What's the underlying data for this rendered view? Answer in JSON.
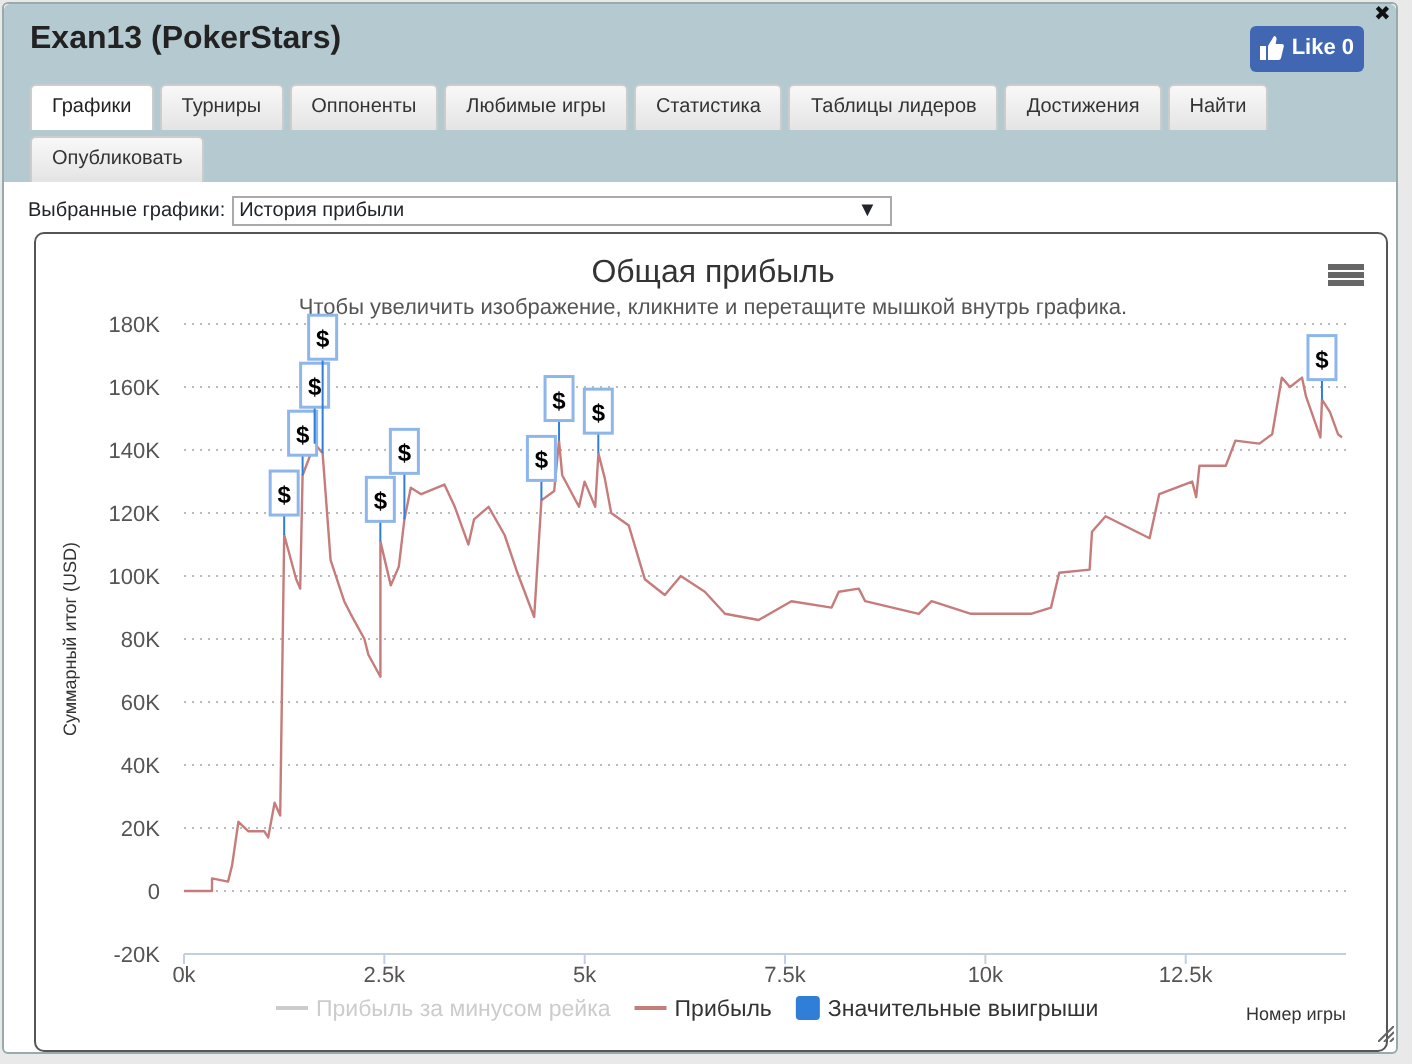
{
  "window": {
    "title": "Exan13 (PokerStars)",
    "close": "✖"
  },
  "like_button": {
    "label": "Like 0"
  },
  "tabs": [
    {
      "label": "Графики",
      "selected": true
    },
    {
      "label": "Турниры",
      "selected": false
    },
    {
      "label": "Оппоненты",
      "selected": false
    },
    {
      "label": "Любимые игры",
      "selected": false
    },
    {
      "label": "Статистика",
      "selected": false
    },
    {
      "label": "Таблицы лидеров",
      "selected": false
    },
    {
      "label": "Достижения",
      "selected": false
    },
    {
      "label": "Найти",
      "selected": false
    },
    {
      "label": "Опубликовать",
      "selected": false
    }
  ],
  "chart_select": {
    "label": "Выбранные графики:",
    "value": "История прибыли",
    "arrow": "▼"
  },
  "chart_panel": {
    "series_states": [
      {
        "visible": false
      },
      {
        "visible": true
      }
    ],
    "legend_extra": [
      {
        "name": "Значительные выигрыши",
        "color": "#2f7ed8",
        "kind": "flag"
      }
    ],
    "chart_data": {
      "type": "line",
      "title": "Общая прибыль",
      "subtitle": "Чтобы увеличить изображение, кликните и перетащите мышкой внутрь графика.",
      "xlabel": "Номер игры",
      "ylabel": "Суммарный итог (USD)",
      "grid": true,
      "legend": true,
      "x": [
        0,
        350,
        350,
        550,
        600,
        680,
        800,
        1000,
        1050,
        1130,
        1200,
        1250,
        1400,
        1450,
        1480,
        1630,
        1730,
        1830,
        2000,
        2080,
        2250,
        2300,
        2450,
        2450,
        2580,
        2680,
        2750,
        2830,
        2960,
        3250,
        3380,
        3550,
        3620,
        3800,
        4000,
        4160,
        4370,
        4460,
        4620,
        4680,
        4720,
        4930,
        5000,
        5130,
        5170,
        5250,
        5330,
        5550,
        5750,
        6000,
        6200,
        6500,
        6750,
        7170,
        7580,
        8080,
        8170,
        8420,
        8500,
        9170,
        9330,
        9820,
        10570,
        10820,
        10920,
        11300,
        11330,
        11500,
        12050,
        12170,
        12580,
        12630,
        12670,
        13000,
        13120,
        13420,
        13580,
        13700,
        13800,
        13950,
        14000,
        14180,
        14200,
        14300,
        14400,
        14450
      ],
      "series": [
        {
          "name": "Прибыль за минусом рейка",
          "color": "#cccccc",
          "values": [
            null,
            null,
            null,
            null,
            null,
            null,
            null,
            null,
            null,
            null,
            null,
            null,
            null,
            null,
            null,
            null,
            null,
            null,
            null,
            null,
            null,
            null,
            null,
            null,
            null,
            null,
            null,
            null,
            null,
            null,
            null,
            null,
            null,
            null,
            null,
            null,
            null,
            null,
            null,
            null,
            null,
            null,
            null,
            null,
            null,
            null,
            null,
            null,
            null,
            null,
            null,
            null,
            null,
            null,
            null,
            null,
            null,
            null,
            null,
            null,
            null,
            null,
            null,
            null,
            null,
            null,
            null,
            null,
            null,
            null,
            null,
            null,
            null,
            null,
            null,
            null,
            null,
            null,
            null,
            null,
            null,
            null,
            null,
            null,
            null,
            null
          ]
        },
        {
          "name": "Прибыль",
          "color": "#c77c7c",
          "values": [
            0,
            0,
            4,
            3,
            8,
            22,
            19,
            19,
            17,
            28,
            24,
            113,
            99,
            96,
            132,
            142,
            139,
            105,
            92,
            88,
            80,
            75,
            68,
            111,
            97,
            103,
            118,
            128,
            126,
            129,
            122,
            110,
            118,
            122,
            113,
            101,
            87,
            124,
            127,
            143,
            132,
            122,
            130,
            122,
            139,
            131,
            120,
            116,
            99,
            94,
            100,
            95,
            88,
            86,
            92,
            90,
            95,
            96,
            92,
            88,
            92,
            88,
            88,
            90,
            101,
            102,
            114,
            119,
            112,
            126,
            130,
            125,
            135,
            135,
            143,
            142,
            145,
            163,
            160,
            163,
            157,
            144,
            156,
            152,
            145,
            144
          ]
        }
      ],
      "annotations": [
        {
          "x": 1250,
          "y": 113,
          "text": "$"
        },
        {
          "x": 1480,
          "y": 132,
          "text": "$"
        },
        {
          "x": 1630,
          "y": 142,
          "text": "$"
        },
        {
          "x": 1730,
          "y": 139,
          "text": "$"
        },
        {
          "x": 2450,
          "y": 111,
          "text": "$"
        },
        {
          "x": 2750,
          "y": 118,
          "text": "$"
        },
        {
          "x": 4460,
          "y": 124,
          "text": "$"
        },
        {
          "x": 4680,
          "y": 143,
          "text": "$"
        },
        {
          "x": 5170,
          "y": 139,
          "text": "$"
        },
        {
          "x": 14200,
          "y": 156,
          "text": "$"
        }
      ],
      "xlim": [
        0,
        14500
      ],
      "ylim": [
        -20,
        180
      ],
      "xticks": [
        {
          "value": 0,
          "label": "0k"
        },
        {
          "value": 2500,
          "label": "2.5k"
        },
        {
          "value": 5000,
          "label": "5k"
        },
        {
          "value": 7500,
          "label": "7.5k"
        },
        {
          "value": 10000,
          "label": "10k"
        },
        {
          "value": 12500,
          "label": "12.5k"
        }
      ],
      "yticks": [
        {
          "value": -20,
          "label": "-20K"
        },
        {
          "value": 0,
          "label": "0"
        },
        {
          "value": 20,
          "label": "20K"
        },
        {
          "value": 40,
          "label": "40K"
        },
        {
          "value": 60,
          "label": "60K"
        },
        {
          "value": 80,
          "label": "80K"
        },
        {
          "value": 100,
          "label": "100K"
        },
        {
          "value": 120,
          "label": "120K"
        },
        {
          "value": 140,
          "label": "140K"
        },
        {
          "value": 160,
          "label": "160K"
        },
        {
          "value": 180,
          "label": "180K"
        }
      ]
    }
  }
}
